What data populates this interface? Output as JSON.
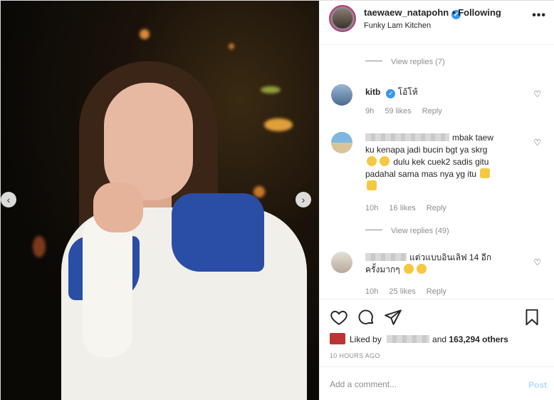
{
  "header": {
    "username": "taewaew_natapohn",
    "verified_icon": "verified-badge-icon",
    "separator": "•",
    "follow_status": "Following",
    "location": "Funky Lam Kitchen",
    "more_icon": "more-options-icon"
  },
  "comments": [
    {
      "type": "view_replies",
      "label": "View replies (7)"
    },
    {
      "username": "kitb",
      "verified": true,
      "text": "โอ้โห้",
      "time": "9h",
      "likes": "59 likes",
      "reply": "Reply"
    },
    {
      "username_hidden": true,
      "text_lines": [
        "mbak taew",
        "ku kenapa jadi bucin bgt ya skrg",
        "dulu kek cuek2 sadis gitu",
        "padahal sama mas nya yg itu"
      ],
      "time": "10h",
      "likes": "16 likes",
      "reply": "Reply"
    },
    {
      "type": "view_replies",
      "label": "View replies (49)"
    },
    {
      "username_hidden": true,
      "text_lines": [
        "แต่วแบบอินเลิฟ 14 อีก",
        "ครั้งมากๆ"
      ],
      "time": "10h",
      "likes": "25 likes",
      "reply": "Reply"
    }
  ],
  "actions": {
    "like_icon": "heart-icon",
    "comment_icon": "comment-icon",
    "share_icon": "share-icon",
    "save_icon": "bookmark-icon"
  },
  "likes": {
    "prefix": "Liked by",
    "connector": "and",
    "others": "163,294 others"
  },
  "timestamp": "10 HOURS AGO",
  "add_comment": {
    "placeholder": "Add a comment...",
    "post_label": "Post"
  },
  "colors": {
    "verified_blue": "#3897f0",
    "muted_text": "#8e8e8e",
    "post_disabled": "#b3dbff",
    "story_ring": "#c13584"
  }
}
